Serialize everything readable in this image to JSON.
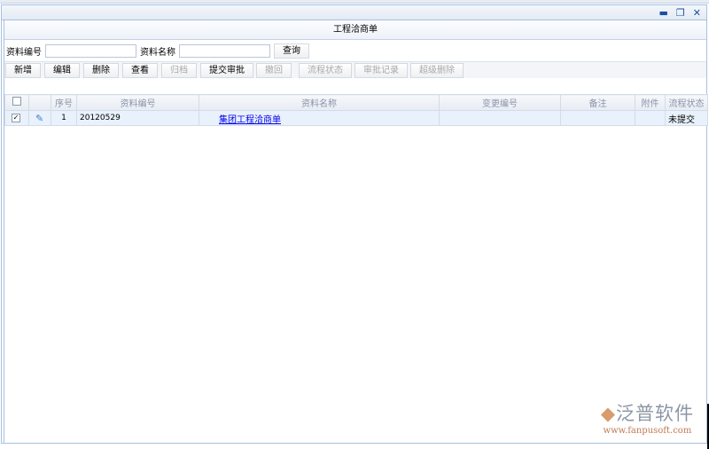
{
  "panel_title": "工程洽商单",
  "search": {
    "code_label": "资料编号",
    "code_value": "",
    "name_label": "资料名称",
    "name_value": "",
    "query_button": "查询"
  },
  "toolbar": [
    {
      "label": "新增",
      "enabled": true
    },
    {
      "label": "编辑",
      "enabled": true
    },
    {
      "label": "删除",
      "enabled": true
    },
    {
      "label": "查看",
      "enabled": true
    },
    {
      "label": "归档",
      "enabled": false
    },
    {
      "label": "提交审批",
      "enabled": true
    },
    {
      "label": "撤回",
      "enabled": false
    },
    {
      "label": "流程状态",
      "enabled": false
    },
    {
      "label": "审批记录",
      "enabled": false
    },
    {
      "label": "超级删除",
      "enabled": false
    }
  ],
  "columns": [
    "",
    "",
    "序号",
    "资料编号",
    "资料名称",
    "变更编号",
    "备注",
    "附件",
    "流程状态"
  ],
  "rows": [
    {
      "checked": true,
      "seq": "1",
      "code": "20120529",
      "name": "集团工程洽商单",
      "change_no": "",
      "remark": "",
      "attachment": "",
      "status": "未提交"
    }
  ],
  "logo": {
    "name": "泛普软件",
    "url": "www.fanpusoft.com"
  }
}
